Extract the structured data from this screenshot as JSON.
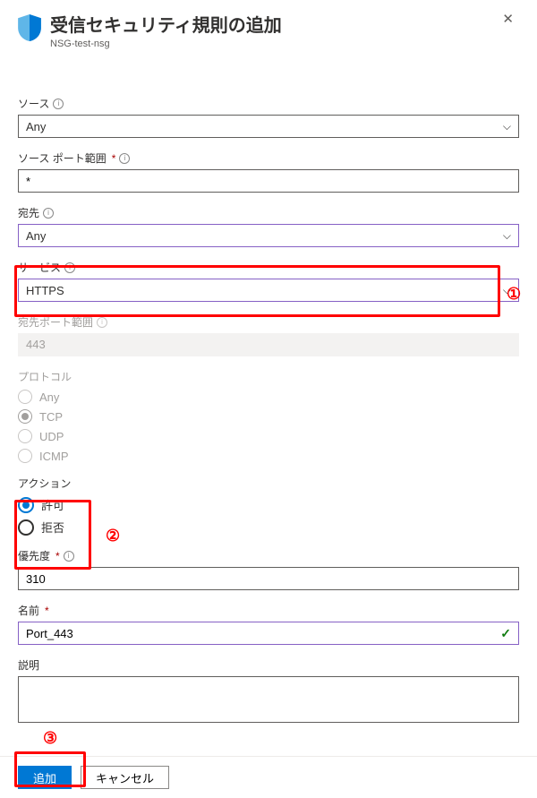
{
  "header": {
    "title": "受信セキュリティ規則の追加",
    "subtitle": "NSG-test-nsg"
  },
  "source": {
    "label": "ソース",
    "value": "Any"
  },
  "sourcePort": {
    "label": "ソース ポート範囲",
    "value": "*"
  },
  "destination": {
    "label": "宛先",
    "value": "Any"
  },
  "service": {
    "label": "サービス",
    "value": "HTTPS"
  },
  "destPort": {
    "label": "宛先ポート範囲",
    "value": "443"
  },
  "protocol": {
    "label": "プロトコル",
    "options": {
      "any": "Any",
      "tcp": "TCP",
      "udp": "UDP",
      "icmp": "ICMP"
    },
    "selected": "tcp"
  },
  "action": {
    "label": "アクション",
    "options": {
      "allow": "許可",
      "deny": "拒否"
    },
    "selected": "allow"
  },
  "priority": {
    "label": "優先度",
    "value": "310"
  },
  "name": {
    "label": "名前",
    "value": "Port_443"
  },
  "description": {
    "label": "説明",
    "value": ""
  },
  "footer": {
    "add": "追加",
    "cancel": "キャンセル"
  },
  "annotations": {
    "one": "①",
    "two": "②",
    "three": "③"
  }
}
